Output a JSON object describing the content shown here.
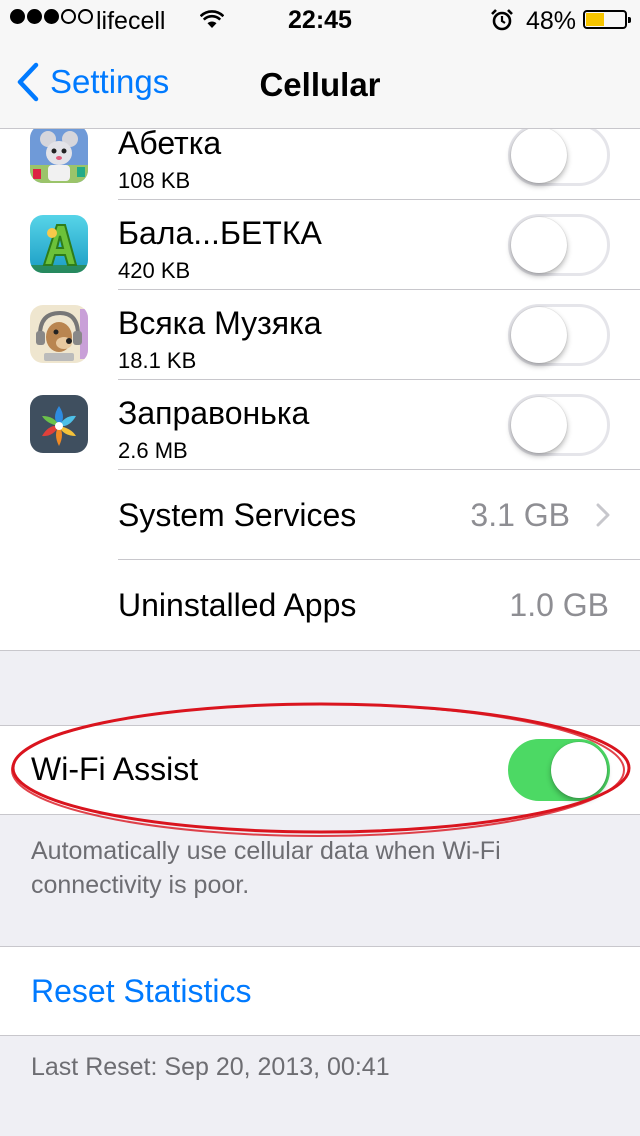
{
  "status_bar": {
    "carrier": "lifecell",
    "time": "22:45",
    "battery_percent": "48%",
    "battery_level": 0.48,
    "signal_bars": 3,
    "signal_total": 5
  },
  "nav": {
    "back_label": "Settings",
    "title": "Cellular"
  },
  "apps": [
    {
      "name": "Абетка",
      "size": "108 KB",
      "enabled": false,
      "icon": "mouse-abc-app-icon"
    },
    {
      "name": "Бала...БЕТКА",
      "size": "420 KB",
      "enabled": false,
      "icon": "green-letter-a-app-icon"
    },
    {
      "name": "Всяка Музяка",
      "size": "18.1 KB",
      "enabled": false,
      "icon": "dog-headphones-app-icon"
    },
    {
      "name": "Заправонька",
      "size": "2.6 MB",
      "enabled": false,
      "icon": "colorful-flower-app-icon"
    }
  ],
  "system_services": {
    "label": "System Services",
    "value": "3.1 GB"
  },
  "uninstalled_apps": {
    "label": "Uninstalled Apps",
    "value": "1.0 GB"
  },
  "wifi_assist": {
    "label": "Wi-Fi Assist",
    "enabled": true,
    "description": "Automatically use cellular data when Wi-Fi connectivity is poor."
  },
  "reset": {
    "label": "Reset Statistics",
    "last_reset": "Last Reset: Sep 20, 2013, 00:41"
  },
  "colors": {
    "accent": "#007aff",
    "toggle_on": "#4cd964",
    "annotation": "#d9141e",
    "background": "#efeff4"
  }
}
